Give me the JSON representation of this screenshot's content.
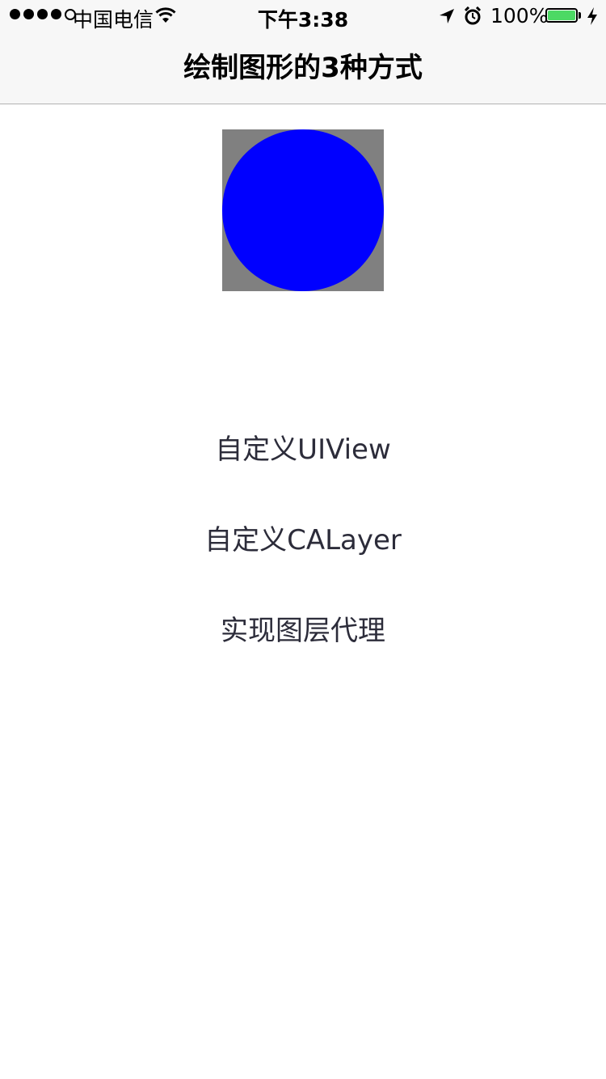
{
  "status_bar": {
    "carrier": "中国电信",
    "time": "下午3:38",
    "battery_percent": "100%",
    "signal_bars_filled": 4,
    "signal_bars_total": 5,
    "battery_level": 1.0,
    "icons": [
      "wifi-icon",
      "location-arrow-icon",
      "alarm-clock-icon",
      "battery-icon",
      "charging-bolt-icon"
    ],
    "battery_color": "#4cd964"
  },
  "nav": {
    "title": "绘制图形的3种方式"
  },
  "drawing": {
    "background_color": "#808080",
    "circle_color": "#0000ff"
  },
  "menu": {
    "items": [
      {
        "label": "自定义UIView"
      },
      {
        "label": "自定义CALayer"
      },
      {
        "label": "实现图层代理"
      }
    ]
  }
}
